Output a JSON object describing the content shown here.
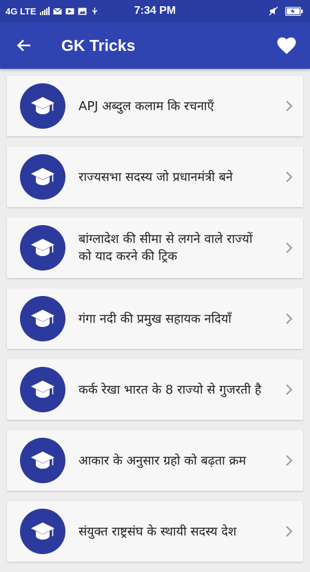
{
  "status_bar": {
    "network": "4G LTE",
    "time": "7:34 PM"
  },
  "toolbar": {
    "title": "GK Tricks",
    "back_icon": "arrow-left-icon",
    "favorite_icon": "heart-icon"
  },
  "list": {
    "item_icon": "graduation-cap-icon",
    "items": [
      {
        "title": "APJ अब्दुल कलाम कि रचनाएँ"
      },
      {
        "title": "राज्यसभा सदस्य जो प्रधानमंत्री बने"
      },
      {
        "title": "बांग्लादेश की सीमा से लगने वाले राज्यों को याद करने की ट्रिक"
      },
      {
        "title": "गंगा नदी की प्रमुख सहायक नदियाँ"
      },
      {
        "title": "कर्क रेखा भारत के 8 राज्यो से गुजरती है"
      },
      {
        "title": "आकार के अनुसार ग्रहो को बढ़ता क्रम"
      },
      {
        "title": "संयुक्त राष्ट्रसंघ के स्थायी सदस्य देश"
      }
    ]
  },
  "colors": {
    "status_bar": "#2a3da4",
    "toolbar": "#2f44b0",
    "avatar": "#2b3a9c",
    "background": "#ededed",
    "card": "#f7f7f7"
  }
}
